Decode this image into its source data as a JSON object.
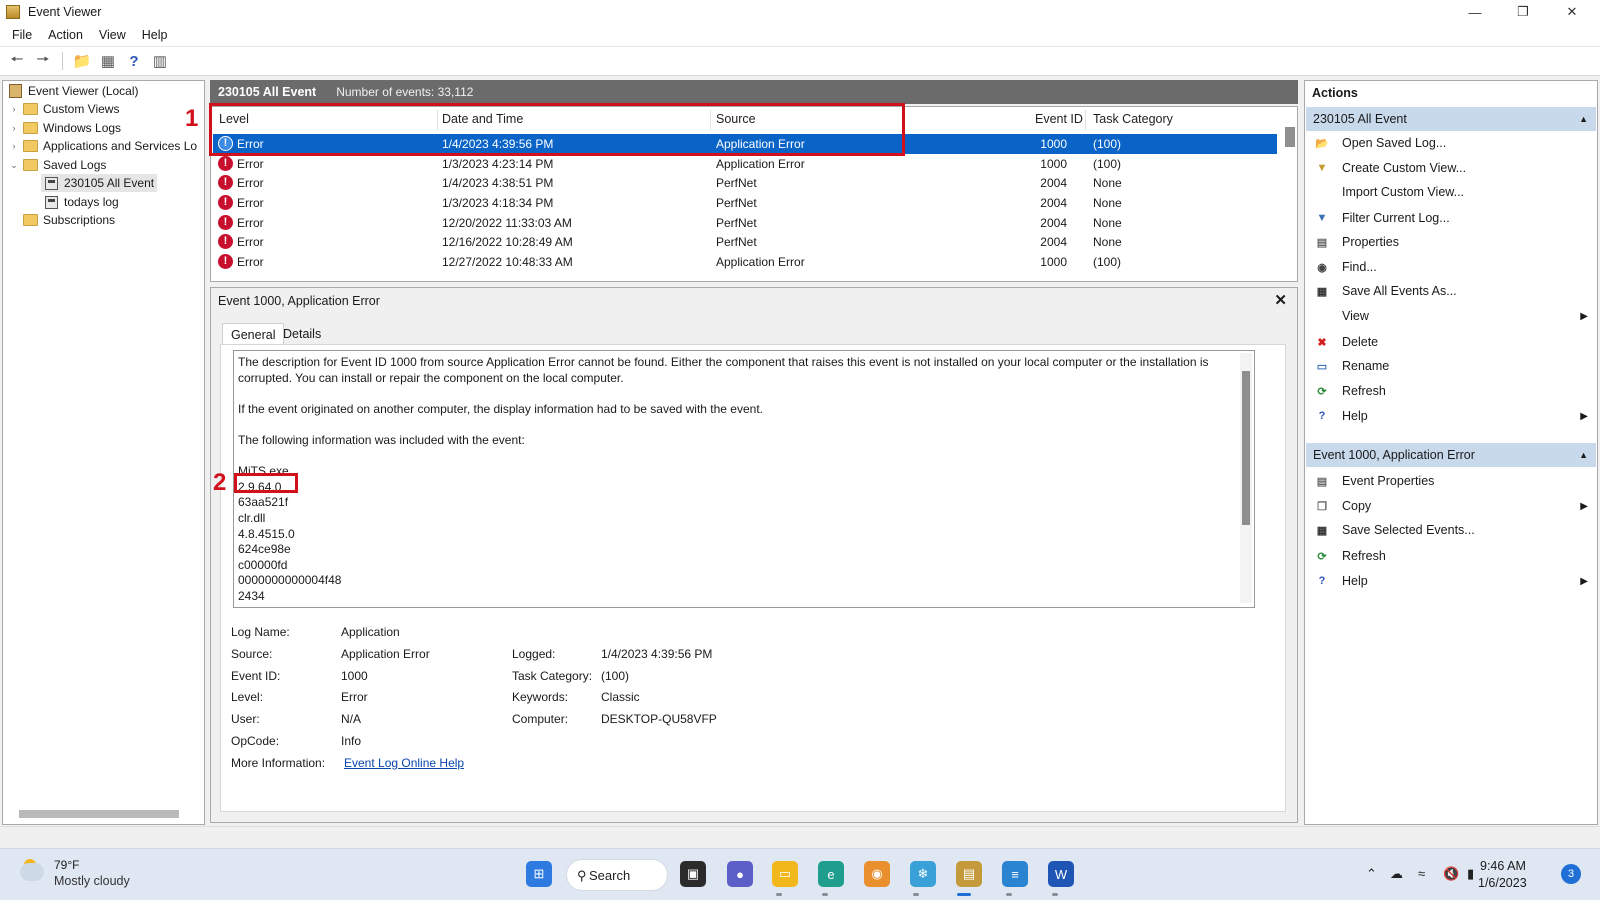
{
  "window": {
    "title": "Event Viewer"
  },
  "menu": [
    "File",
    "Action",
    "View",
    "Help"
  ],
  "tree": {
    "root": "Event Viewer (Local)",
    "custom_views": "Custom Views",
    "windows_logs": "Windows Logs",
    "app_services_logs": "Applications and Services Lo",
    "saved_logs": "Saved Logs",
    "saved_log_1": "230105 All Event",
    "saved_log_2": "todays log",
    "subscriptions": "Subscriptions"
  },
  "list": {
    "log_title": "230105 All Event",
    "count_text": "Number of events: 33,112",
    "columns": [
      "Level",
      "Date and Time",
      "Source",
      "Event ID",
      "Task Category"
    ],
    "rows": [
      {
        "level": "Error",
        "datetime": "1/4/2023 4:39:56 PM",
        "source": "Application Error",
        "event_id": "1000",
        "task": "(100)"
      },
      {
        "level": "Error",
        "datetime": "1/3/2023 4:23:14 PM",
        "source": "Application Error",
        "event_id": "1000",
        "task": "(100)"
      },
      {
        "level": "Error",
        "datetime": "1/4/2023 4:38:51 PM",
        "source": "PerfNet",
        "event_id": "2004",
        "task": "None"
      },
      {
        "level": "Error",
        "datetime": "1/3/2023 4:18:34 PM",
        "source": "PerfNet",
        "event_id": "2004",
        "task": "None"
      },
      {
        "level": "Error",
        "datetime": "12/20/2022 11:33:03 AM",
        "source": "PerfNet",
        "event_id": "2004",
        "task": "None"
      },
      {
        "level": "Error",
        "datetime": "12/16/2022 10:28:49 AM",
        "source": "PerfNet",
        "event_id": "2004",
        "task": "None"
      },
      {
        "level": "Error",
        "datetime": "12/27/2022 10:48:33 AM",
        "source": "Application Error",
        "event_id": "1000",
        "task": "(100)"
      }
    ]
  },
  "detail": {
    "title": "Event 1000, Application Error",
    "tabs": [
      "General",
      "Details"
    ],
    "description": {
      "p1": "The description for Event ID 1000 from source Application Error cannot be found. Either the component that raises this event is not installed on your local computer or the installation is corrupted. You can install or repair the component on the local computer.",
      "p2": "If the event originated on another computer, the display information had to be saved with the event.",
      "p3": "The following information was included with the event:",
      "data_lines": [
        "MiTS.exe",
        "2.9.64.0",
        "63aa521f",
        "clr.dll",
        "4.8.4515.0",
        "624ce98e",
        "c00000fd",
        "0000000000004f48",
        "2434"
      ]
    },
    "props": {
      "log_name_label": "Log Name:",
      "log_name": "Application",
      "source_label": "Source:",
      "source": "Application Error",
      "event_id_label": "Event ID:",
      "event_id": "1000",
      "level_label": "Level:",
      "level": "Error",
      "user_label": "User:",
      "user": "N/A",
      "opcode_label": "OpCode:",
      "opcode": "Info",
      "more_info_label": "More Information:",
      "more_info_link": "Event Log Online Help",
      "logged_label": "Logged:",
      "logged": "1/4/2023 4:39:56 PM",
      "task_label": "Task Category:",
      "task": "(100)",
      "keywords_label": "Keywords:",
      "keywords": "Classic",
      "computer_label": "Computer:",
      "computer": "DESKTOP-QU58VFP"
    }
  },
  "annotations": {
    "n1": "1",
    "n2": "2"
  },
  "actions": {
    "title": "Actions",
    "section1": "230105 All Event",
    "section1_items": [
      "Open Saved Log...",
      "Create Custom View...",
      "Import Custom View...",
      "Filter Current Log...",
      "Properties",
      "Find...",
      "Save All Events As...",
      "View",
      "Delete",
      "Rename",
      "Refresh",
      "Help"
    ],
    "section2": "Event 1000, Application Error",
    "section2_items": [
      "Event Properties",
      "Copy",
      "Save Selected Events...",
      "Refresh",
      "Help"
    ]
  },
  "taskbar": {
    "temp": "79°F",
    "condition": "Mostly cloudy",
    "search": "Search",
    "time": "9:46 AM",
    "date": "1/6/2023",
    "notifications": "3"
  },
  "colors": {
    "selection": "#0a64c8",
    "annotation": "#d1101c",
    "actions_header": "#c9d9ec"
  }
}
